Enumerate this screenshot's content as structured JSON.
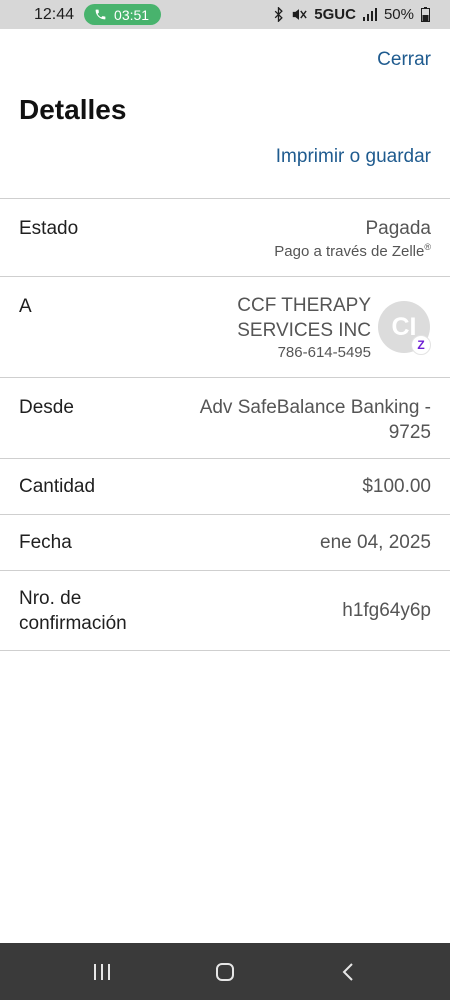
{
  "status_bar": {
    "time": "12:44",
    "call_timer": "03:51",
    "network": "5GUC",
    "battery": "50%"
  },
  "header": {
    "close_label": "Cerrar",
    "title": "Detalles",
    "print_label": "Imprimir o guardar"
  },
  "details": {
    "estado": {
      "label": "Estado",
      "value": "Pagada",
      "sub": "Pago a través de Zelle"
    },
    "a": {
      "label": "A",
      "name": "CCF THERAPY SERVICES INC",
      "phone": "786-614-5495",
      "avatar_initials": "CI"
    },
    "desde": {
      "label": "Desde",
      "value": "Adv SafeBalance Banking - 9725"
    },
    "cantidad": {
      "label": "Cantidad",
      "value": "$100.00"
    },
    "fecha": {
      "label": "Fecha",
      "value": "ene 04, 2025"
    },
    "confirmacion": {
      "label": "Nro. de confirmación",
      "value": "h1fg64y6p"
    }
  },
  "icons": {
    "zelle_badge": "zelle-icon",
    "nav": [
      "recent-apps-icon",
      "home-icon",
      "back-icon"
    ]
  },
  "colors": {
    "link": "#1f5b8f",
    "call_pill": "#48b36d",
    "zelle": "#6d1ed4"
  }
}
